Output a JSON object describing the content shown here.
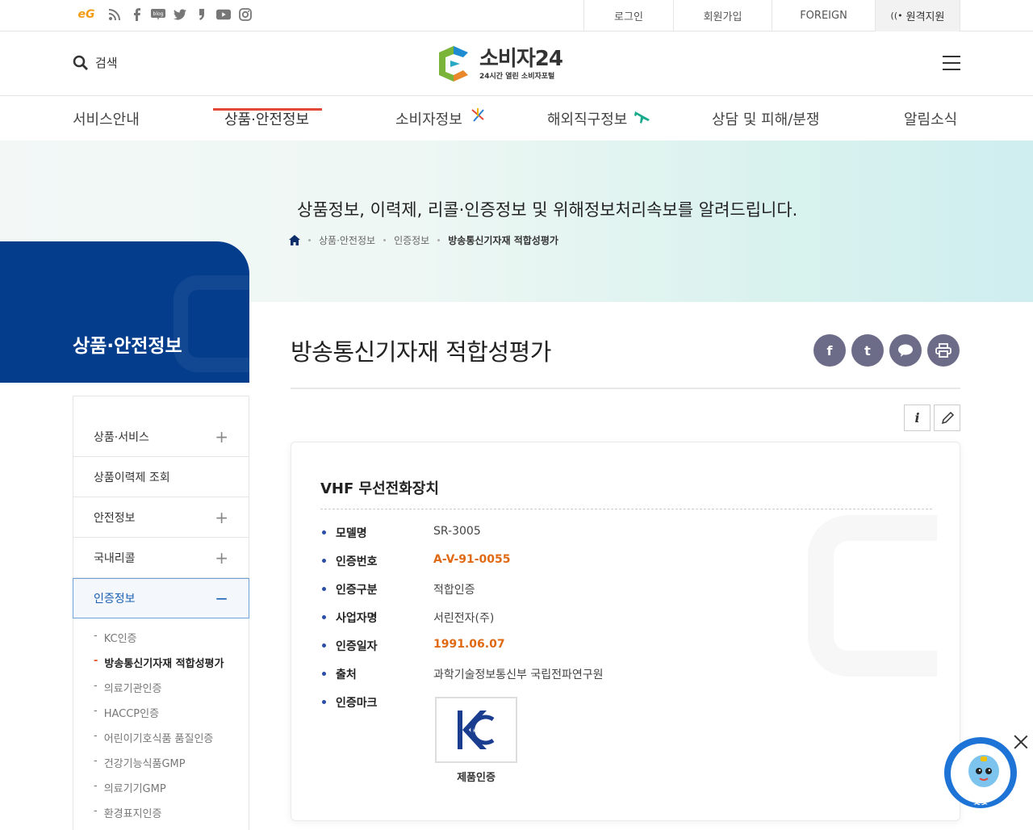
{
  "topbar": {
    "sns_icons": [
      "eg-icon",
      "rss-icon",
      "facebook-icon",
      "blog-icon",
      "twitter-icon",
      "post-icon",
      "youtube-icon",
      "instagram-icon"
    ],
    "eg_label": "eG",
    "blog_label": "blog",
    "login": "로그인",
    "signup": "회원가입",
    "foreign": "FOREIGN",
    "remote": "원격지원"
  },
  "header": {
    "search_label": "검색",
    "logo_title": "소비자24",
    "logo_sub": "24시간 열린 소비자포털"
  },
  "gnb": {
    "items": [
      "서비스안내",
      "상품·안전정보",
      "소비자정보",
      "해외직구정보",
      "상담 및 피해/분쟁",
      "알림소식"
    ],
    "active_index": 1
  },
  "hero": {
    "text": "상품정보, 이력제, 리콜·인증정보 및 위해정보처리속보를 알려드립니다.",
    "breadcrumb": [
      "상품·안전정보",
      "인증정보",
      "방송통신기자재 적합성평가"
    ]
  },
  "lnb": {
    "title": "상품·안전정보",
    "items": [
      {
        "label": "상품·서비스",
        "toggle": "+"
      },
      {
        "label": "상품이력제 조회",
        "toggle": ""
      },
      {
        "label": "안전정보",
        "toggle": "+"
      },
      {
        "label": "국내리콜",
        "toggle": "+"
      },
      {
        "label": "인증정보",
        "toggle": "−"
      }
    ],
    "sub_items": [
      "KC인증",
      "방송통신기자재 적합성평가",
      "의료기관인증",
      "HACCP인증",
      "어린이기호식품 품질인증",
      "건강기능식품GMP",
      "의료기기GMP",
      "환경표지인증"
    ],
    "sub_active_index": 1
  },
  "content": {
    "title": "방송통신기자재 적합성평가",
    "share_icons": [
      "facebook-share-icon",
      "twitter-share-icon",
      "kakaotalk-share-icon",
      "print-icon"
    ],
    "tools": [
      "info-icon",
      "edit-icon"
    ],
    "card_title": "VHF 무선전화장치",
    "fields": [
      {
        "key": "모델명",
        "value": "SR-3005",
        "highlight": false
      },
      {
        "key": "인증번호",
        "value": "A-V-91-0055",
        "highlight": true
      },
      {
        "key": "인증구분",
        "value": "적합인증",
        "highlight": false
      },
      {
        "key": "사업자명",
        "value": "서린전자(주)",
        "highlight": false
      },
      {
        "key": "인증일자",
        "value": "1991.06.07",
        "highlight": true
      },
      {
        "key": "출처",
        "value": "과학기술정보통신부 국립전파연구원",
        "highlight": false
      },
      {
        "key": "인증마크",
        "value": "",
        "highlight": false
      }
    ],
    "mark_label": "제품인증",
    "mark_text": "KC"
  },
  "chatbot": {
    "label": "챗봇"
  },
  "colors": {
    "primary": "#043d8c",
    "accent": "#e2473a",
    "highlight": "#e06a14",
    "share": "#6c6c88"
  }
}
